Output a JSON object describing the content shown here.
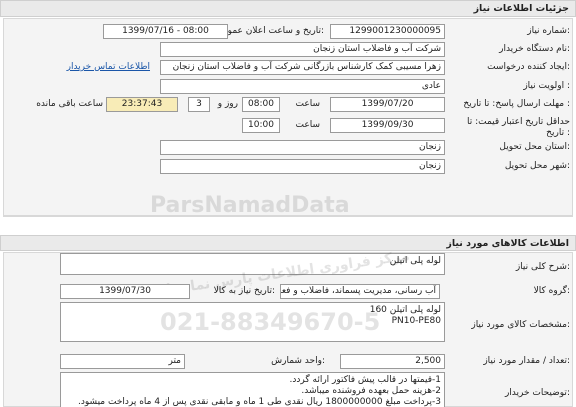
{
  "header": {
    "title": "جزئیات اطلاعات نیاز"
  },
  "need_info": {
    "need_number_label": "شماره نیاز:",
    "need_number": "1299001230000095",
    "announce_label": "تاریخ و ساعت اعلان عمومی:",
    "announce_value": "1399/07/16 - 08:00",
    "buyer_label": "نام دستگاه خریدار:",
    "buyer_value": "شرکت آب و فاضلاب استان زنجان",
    "creator_label": "ایجاد کننده درخواست:",
    "creator_value": "زهرا مسیبی کمک کارشناس بازرگانی شرکت آب و فاضلاب استان زنجان",
    "contact_link": "اطلاعات تماس خریدار",
    "priority_label": "اولویت نیاز :",
    "priority_value": "عادی",
    "reply_label": "مهلت ارسال پاسخ: تا تاریخ :",
    "reply_date": "1399/07/20",
    "hour_label": "ساعت",
    "reply_time": "08:00",
    "day_label": "روز و",
    "days": "3",
    "countdown": "23:37:43",
    "remaining_label": "ساعت باقی مانده",
    "validity_label": "حداقل تاریخ اعتبار قیمت: تا تاریخ :",
    "validity_date": "1399/09/30",
    "validity_time": "10:00",
    "province_label": "استان محل تحویل:",
    "province_value": "زنجان",
    "city_label": "شهر محل تحویل:",
    "city_value": "زنجان"
  },
  "goods_section": {
    "title": "اطلاعات کالاهای مورد نیاز",
    "general_desc_label": "شرح کلی نیاز:",
    "general_desc_value": "لوله پلی اتیلن",
    "group_label": "گروه کالا:",
    "group_value": "آب رسانی، مدیریت پسماند، فاضلاب و فعالیت ها",
    "need_date_label": "تاریخ نیاز به کالا:",
    "need_date_value": "1399/07/30",
    "spec_label": "مشخصات کالای مورد نیاز:",
    "spec_line1": "لوله پلی اتیلن 160",
    "spec_line2": "PN10-PE80",
    "qty_label": "تعداد / مقدار مورد نیاز:",
    "qty_value": "2,500",
    "unit_label": "واحد شمارش:",
    "unit_value": "متر",
    "buyer_notes_label": "توضیحات خریدار:",
    "notes": [
      "1-قیمتها در قالب پیش فاکتور ارائه گردد.",
      "2-هزینه حمل بعهده فروشنده میباشد.",
      "3-پرداخت مبلغ 1800000000 ریال نقدی طی 1 ماه و مابقی نقدی پس از 4 ماه پرداخت میشود."
    ]
  },
  "watermark": {
    "text1": "ParsNamadData",
    "text2": "مرکز فراوری اطلاعات پارس نماد داده",
    "phone": "021-88349670-5"
  }
}
